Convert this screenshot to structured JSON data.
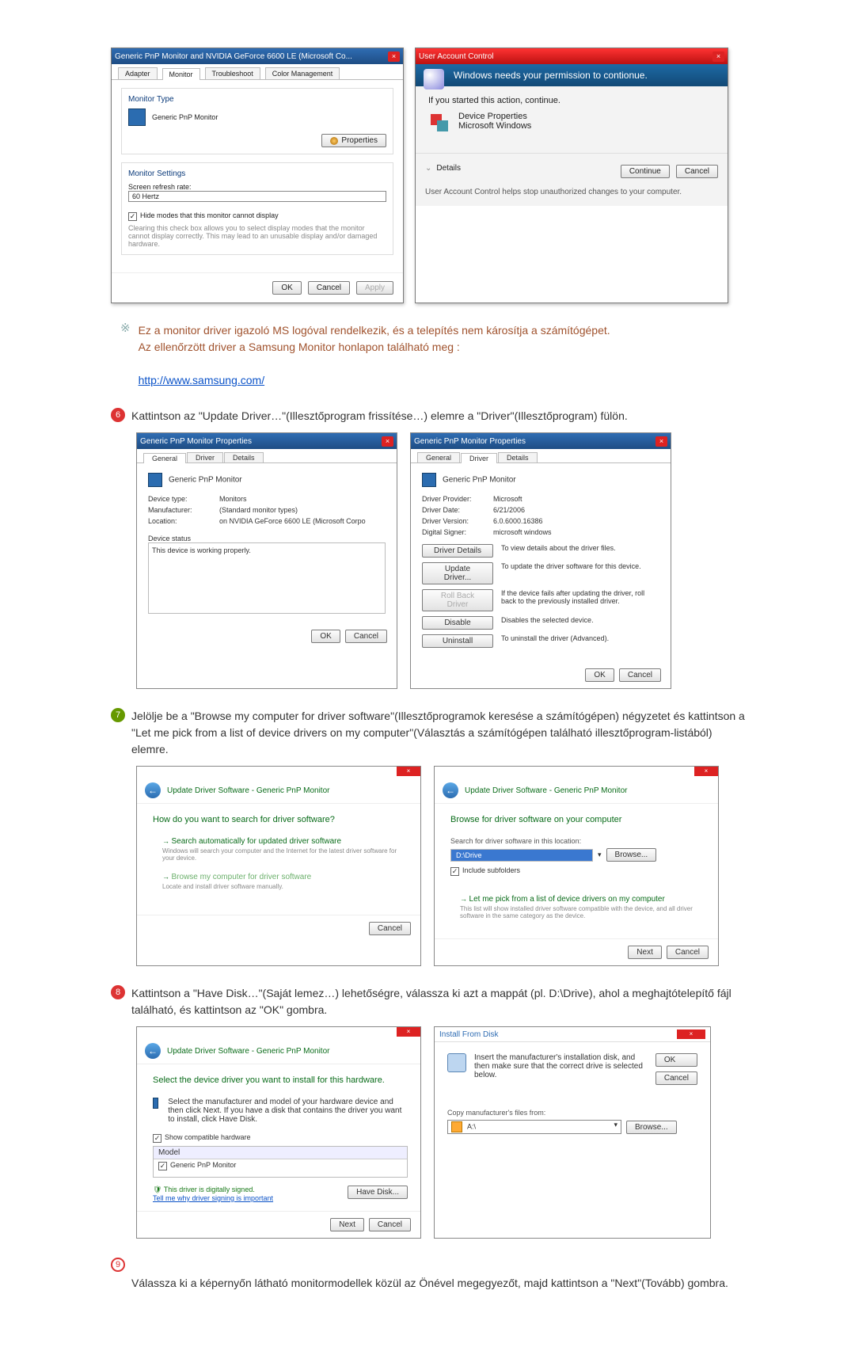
{
  "monitor_dlg": {
    "title": "Generic PnP Monitor and NVIDIA GeForce 6600 LE (Microsoft Co...",
    "tab_adapter": "Adapter",
    "tab_monitor": "Monitor",
    "tab_troubleshoot": "Troubleshoot",
    "tab_colormgmt": "Color Management",
    "monitor_type_label": "Monitor Type",
    "monitor_type_value": "Generic PnP Monitor",
    "properties_btn": "Properties",
    "monitor_settings_label": "Monitor Settings",
    "refresh_rate_label": "Screen refresh rate:",
    "refresh_rate_value": "60 Hertz",
    "hide_modes_label": "Hide modes that this monitor cannot display",
    "hide_modes_desc": "Clearing this check box allows you to select display modes that the monitor cannot display correctly. This may lead to an unusable display and/or damaged hardware.",
    "ok": "OK",
    "cancel": "Cancel",
    "apply": "Apply"
  },
  "uac": {
    "title": "User Account Control",
    "headline": "Windows needs your permission to contionue.",
    "line1": "If you started this action, continue.",
    "prog_name": "Device Properties",
    "publisher": "Microsoft Windows",
    "details": "Details",
    "continue": "Continue",
    "cancel": "Cancel",
    "footer": "User Account Control helps stop unauthorized changes to your computer."
  },
  "note": {
    "line1": "Ez a monitor driver igazoló MS logóval rendelkezik, és a telepítés nem károsítja a számítógépet.",
    "line2": "Az ellenőrzött driver a Samsung Monitor honlapon található meg :",
    "link": "http://www.samsung.com/"
  },
  "step6": {
    "num": "6",
    "text": "Kattintson az \"Update Driver…\"(Illesztőprogram frissítése…) elemre a \"Driver\"(Illesztőprogram) fülön."
  },
  "props_general": {
    "title": "Generic PnP Monitor Properties",
    "tab_general": "General",
    "tab_driver": "Driver",
    "tab_details": "Details",
    "name": "Generic PnP Monitor",
    "dev_type_k": "Device type:",
    "dev_type_v": "Monitors",
    "manuf_k": "Manufacturer:",
    "manuf_v": "(Standard monitor types)",
    "loc_k": "Location:",
    "loc_v": "on NVIDIA GeForce 6600 LE (Microsoft Corpo",
    "status_label": "Device status",
    "status_text": "This device is working properly.",
    "ok": "OK",
    "cancel": "Cancel"
  },
  "props_driver": {
    "title": "Generic PnP Monitor Properties",
    "name": "Generic PnP Monitor",
    "provider_k": "Driver Provider:",
    "provider_v": "Microsoft",
    "date_k": "Driver Date:",
    "date_v": "6/21/2006",
    "version_k": "Driver Version:",
    "version_v": "6.0.6000.16386",
    "signer_k": "Digital Signer:",
    "signer_v": "microsoft windows",
    "btn_details": "Driver Details",
    "desc_details": "To view details about the driver files.",
    "btn_update": "Update Driver...",
    "desc_update": "To update the driver software for this device.",
    "btn_rollback": "Roll Back Driver",
    "desc_rollback": "If the device fails after updating the driver, roll back to the previously installed driver.",
    "btn_disable": "Disable",
    "desc_disable": "Disables the selected device.",
    "btn_uninstall": "Uninstall",
    "desc_uninstall": "To uninstall the driver (Advanced).",
    "ok": "OK",
    "cancel": "Cancel"
  },
  "step7": {
    "num": "7",
    "text": "Jelölje be a \"Browse my computer for driver software\"(Illesztőprogramok keresése a számítógépen) négyzetet és kattintson a \"Let me pick from a list of device drivers on my computer\"(Választás a számítógépen található illesztőprogram-listából) elemre."
  },
  "wiz_search": {
    "breadcrumb": "Update Driver Software - Generic PnP Monitor",
    "heading": "How do you want to search for driver software?",
    "opt1_title": "Search automatically for updated driver software",
    "opt1_desc": "Windows will search your computer and the Internet for the latest driver software for your device.",
    "opt2_title": "Browse my computer for driver software",
    "opt2_desc": "Locate and install driver software manually.",
    "cancel": "Cancel"
  },
  "wiz_browse": {
    "breadcrumb": "Update Driver Software - Generic PnP Monitor",
    "heading": "Browse for driver software on your computer",
    "search_loc_label": "Search for driver software in this location:",
    "path_value": "D:\\Drive",
    "browse_btn": "Browse...",
    "include_sub": "Include subfolders",
    "opt_pick_title": "Let me pick from a list of device drivers on my computer",
    "opt_pick_desc": "This list will show installed driver software compatible with the device, and all driver software in the same category as the device.",
    "next": "Next",
    "cancel": "Cancel"
  },
  "step8": {
    "num": "8",
    "text": "Kattintson a \"Have Disk…\"(Saját lemez…) lehetőségre, válassza ki azt a mappát (pl. D:\\Drive), ahol a meghajtótelepítő fájl található, és kattintson az \"OK\" gombra."
  },
  "wiz_select": {
    "breadcrumb": "Update Driver Software - Generic PnP Monitor",
    "heading": "Select the device driver you want to install for this hardware.",
    "sub": "Select the manufacturer and model of your hardware device and then click Next. If you have a disk that contains the driver you want to install, click Have Disk.",
    "show_compat": "Show compatible hardware",
    "model_hdr": "Model",
    "model_value": "Generic PnP Monitor",
    "signed": "This driver is digitally signed.",
    "tell_me": "Tell me why driver signing is important",
    "have_disk": "Have Disk...",
    "next": "Next",
    "cancel": "Cancel"
  },
  "install_disk": {
    "title": "Install From Disk",
    "main_text": "Insert the manufacturer's installation disk, and then make sure that the correct drive is selected below.",
    "ok": "OK",
    "cancel": "Cancel",
    "copy_from": "Copy manufacturer's files from:",
    "combo_value": "A:\\",
    "browse": "Browse..."
  },
  "step9": {
    "num": "9",
    "text": "Válassza ki a képernyőn látható monitormodellek közül az Önével megegyezőt, majd kattintson a \"Next\"(Tovább) gombra."
  }
}
